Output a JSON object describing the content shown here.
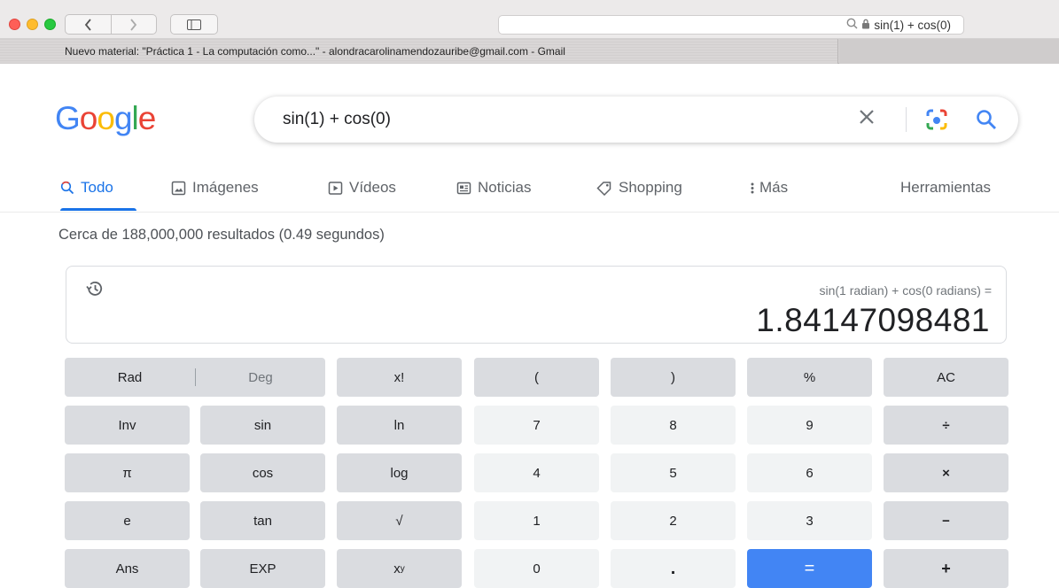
{
  "browser": {
    "address": "sin(1) + cos(0)",
    "tab_title": "Nuevo material: \"Práctica 1 - La computación como...\" - alondracarolinamendozauribe@gmail.com - Gmail"
  },
  "google": {
    "logo_letters": [
      "G",
      "o",
      "o",
      "g",
      "l",
      "e"
    ],
    "logo_colors": [
      "#4285f4",
      "#ea4335",
      "#fbbc05",
      "#4285f4",
      "#34a853",
      "#ea4335"
    ],
    "query": "sin(1) + cos(0)",
    "tabs": [
      {
        "label": "Todo",
        "icon": "search-icon",
        "active": true
      },
      {
        "label": "Imágenes",
        "icon": "image-icon",
        "active": false
      },
      {
        "label": "Vídeos",
        "icon": "play-icon",
        "active": false
      },
      {
        "label": "Noticias",
        "icon": "news-icon",
        "active": false
      },
      {
        "label": "Shopping",
        "icon": "tag-icon",
        "active": false
      },
      {
        "label": "Más",
        "icon": "more-vert-icon",
        "active": false
      }
    ],
    "tools_label": "Herramientas",
    "stats": "Cerca de 188,000,000 resultados (0.49 segundos)",
    "accent": "#1a73e8"
  },
  "calculator": {
    "expression": "sin(1 radian) + cos(0 radians) =",
    "result": "1.84147098481",
    "rad_label": "Rad",
    "deg_label": "Deg",
    "keys": {
      "fact": "x!",
      "lparen": "(",
      "rparen": ")",
      "percent": "%",
      "ac": "AC",
      "inv": "Inv",
      "sin": "sin",
      "ln": "ln",
      "n7": "7",
      "n8": "8",
      "n9": "9",
      "div": "÷",
      "pi": "π",
      "cos": "cos",
      "log": "log",
      "n4": "4",
      "n5": "5",
      "n6": "6",
      "mul": "×",
      "e": "e",
      "tan": "tan",
      "sqrt": "√",
      "n1": "1",
      "n2": "2",
      "n3": "3",
      "sub": "−",
      "ans": "Ans",
      "exp": "EXP",
      "pow_base": "x",
      "pow_sup": "y",
      "n0": "0",
      "dot": ".",
      "eq": "=",
      "add": "+"
    },
    "equals_color": "#4285f4"
  }
}
